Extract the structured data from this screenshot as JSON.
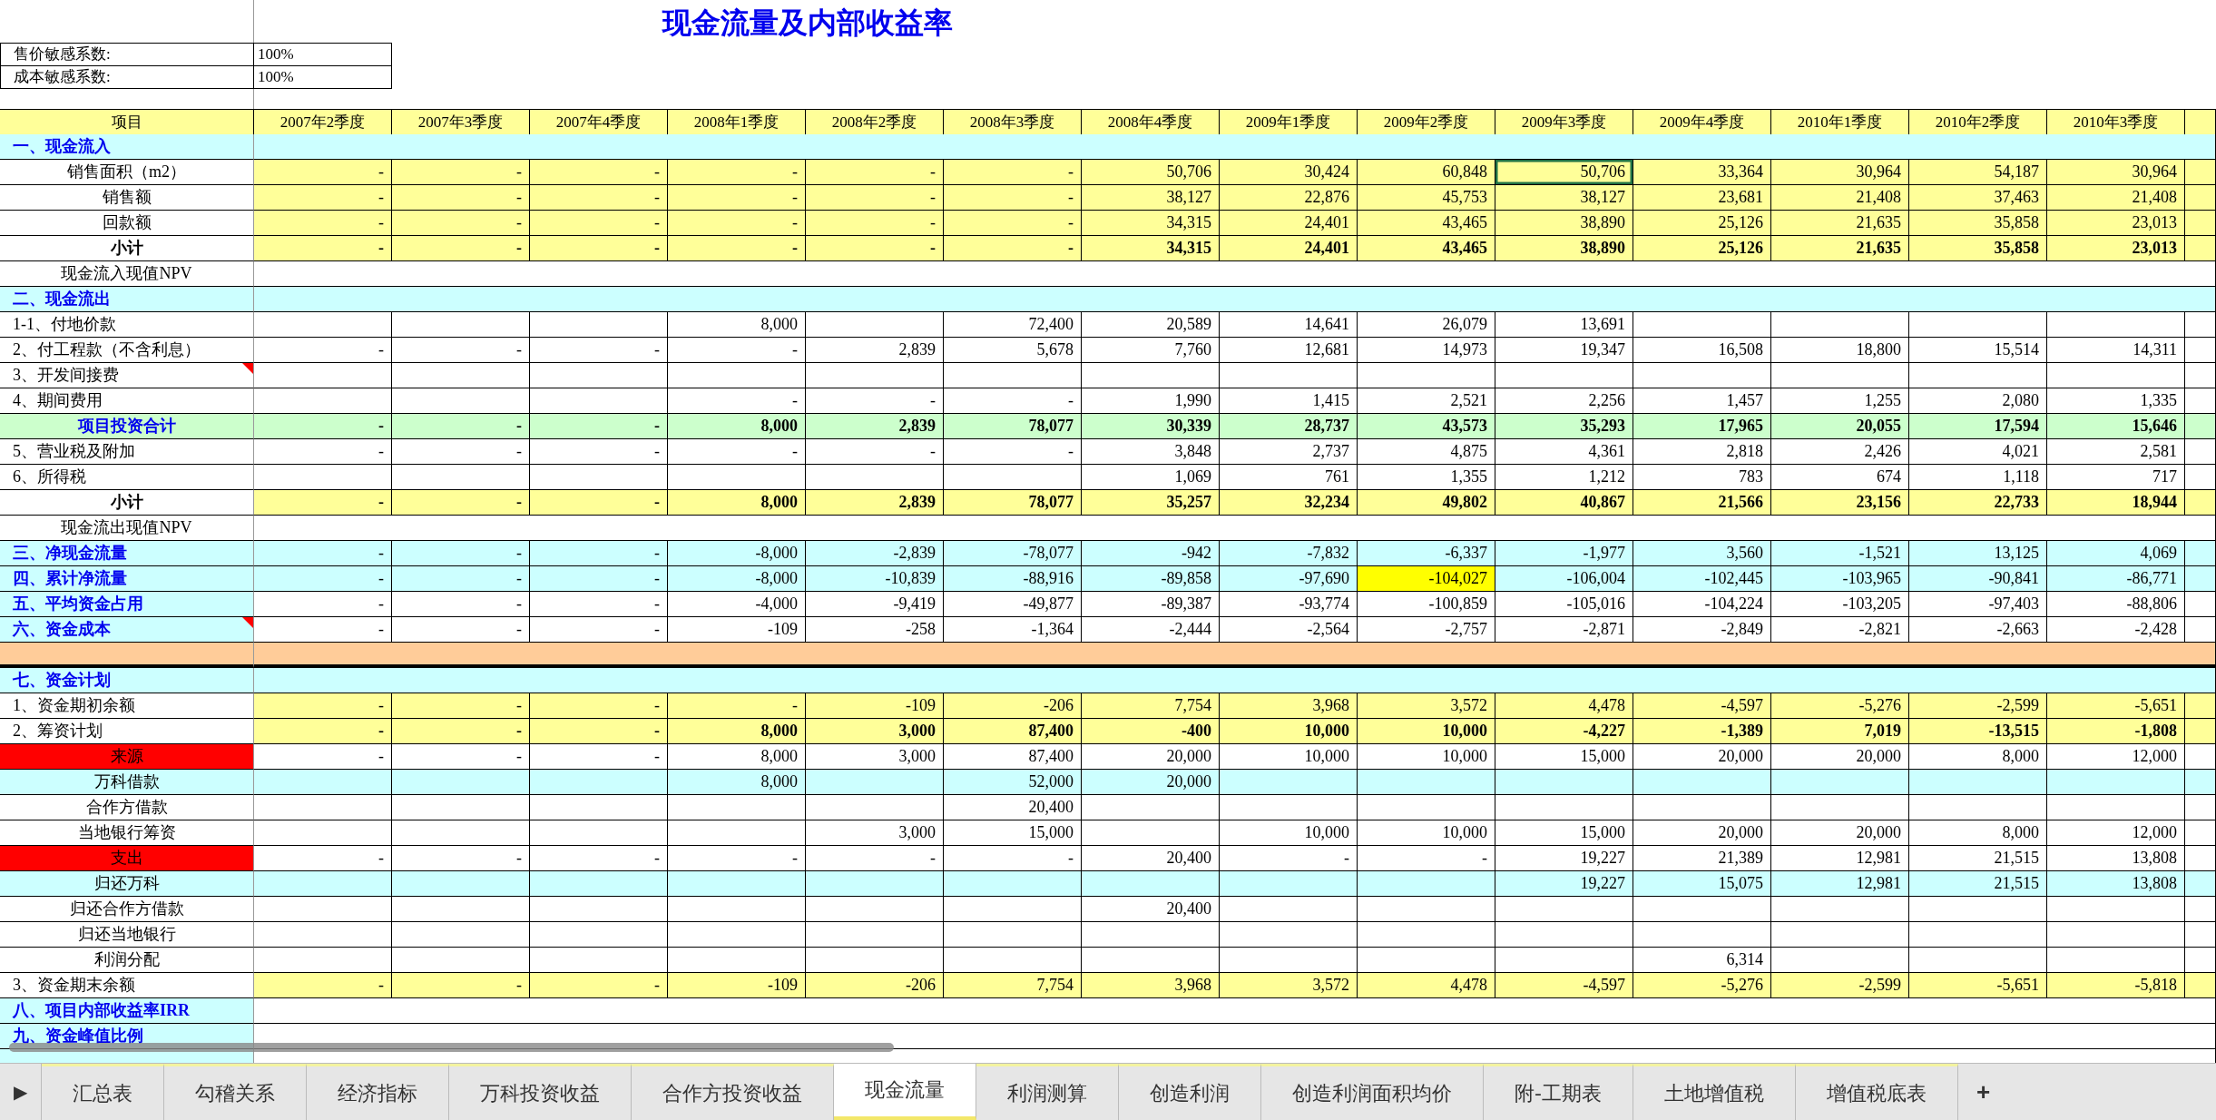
{
  "title": "现金流量及内部收益率",
  "sensitivity": [
    {
      "label": "售价敏感系数:",
      "value": "100%"
    },
    {
      "label": "成本敏感系数:",
      "value": "100%"
    }
  ],
  "header_label": "项目",
  "columns": [
    "2007年2季度",
    "2007年3季度",
    "2007年4季度",
    "2008年1季度",
    "2008年2季度",
    "2008年3季度",
    "2008年4季度",
    "2009年1季度",
    "2009年2季度",
    "2009年3季度",
    "2009年4季度",
    "2010年1季度",
    "2010年2季度",
    "2010年3季度"
  ],
  "rows": [
    {
      "label": "一、现金流入",
      "kind": "section"
    },
    {
      "label": "销售面积（m2）",
      "kind": "yellow_sub",
      "values": [
        "-",
        "-",
        "-",
        "-",
        "-",
        "-",
        "50,706",
        "30,424",
        "60,848",
        {
          "kind": "value",
          "text": "50,706",
          "selected": true
        },
        "33,364",
        "30,964",
        "54,187",
        "30,964"
      ]
    },
    {
      "label": "销售额",
      "kind": "yellow_sub",
      "values": [
        "-",
        "-",
        "-",
        "-",
        "-",
        "-",
        "38,127",
        "22,876",
        "45,753",
        "38,127",
        "23,681",
        "21,408",
        "37,463",
        "21,408"
      ]
    },
    {
      "label": "回款额",
      "kind": "yellow_sub",
      "values": [
        "-",
        "-",
        "-",
        "-",
        "-",
        "-",
        "34,315",
        "24,401",
        "43,465",
        "38,890",
        "25,126",
        "21,635",
        "35,858",
        "23,013"
      ]
    },
    {
      "label": "小计",
      "kind": "subtotal",
      "values": [
        "-",
        "-",
        "-",
        "-",
        "-",
        "-",
        "34,315",
        "24,401",
        "43,465",
        "38,890",
        "25,126",
        "21,635",
        "35,858",
        "23,013"
      ]
    },
    {
      "label": "现金流入现值NPV",
      "kind": "note"
    },
    {
      "label": "二、现金流出",
      "kind": "section"
    },
    {
      "label": "1-1、付地价款",
      "kind": "plain",
      "values": [
        {
          "kind": "blank"
        },
        {
          "kind": "blank"
        },
        {
          "kind": "blank"
        },
        "8,000",
        {
          "kind": "blank"
        },
        "72,400",
        "20,589",
        "14,641",
        "26,079",
        "13,691",
        {
          "kind": "blank"
        },
        {
          "kind": "blank"
        },
        {
          "kind": "blank"
        },
        {
          "kind": "blank"
        }
      ]
    },
    {
      "label": "2、付工程款（不含利息）",
      "kind": "plain",
      "values": [
        "-",
        "-",
        "-",
        "-",
        "2,839",
        "5,678",
        "7,760",
        "12,681",
        "14,973",
        "19,347",
        "16,508",
        "18,800",
        "15,514",
        "14,311"
      ]
    },
    {
      "label": "3、开发间接费",
      "kind": "plain",
      "comment": true
    },
    {
      "label": "4、期间费用",
      "kind": "plain",
      "values": [
        {
          "kind": "blank"
        },
        {
          "kind": "blank"
        },
        {
          "kind": "blank"
        },
        "-",
        "-",
        "-",
        "1,990",
        "1,415",
        "2,521",
        "2,256",
        "1,457",
        "1,255",
        "2,080",
        "1,335"
      ]
    },
    {
      "label": "项目投资合计",
      "kind": "green_total",
      "values": [
        "-",
        "-",
        "-",
        "8,000",
        "2,839",
        "78,077",
        "30,339",
        "28,737",
        "43,573",
        "35,293",
        "17,965",
        "20,055",
        "17,594",
        "15,646"
      ]
    },
    {
      "label": "5、营业税及附加",
      "kind": "plain",
      "values": [
        "-",
        "-",
        "-",
        "-",
        "-",
        "-",
        "3,848",
        "2,737",
        "4,875",
        "4,361",
        "2,818",
        "2,426",
        "4,021",
        "2,581"
      ]
    },
    {
      "label": "6、所得税",
      "kind": "plain",
      "values": [
        {
          "kind": "blank"
        },
        {
          "kind": "blank"
        },
        {
          "kind": "blank"
        },
        {
          "kind": "blank"
        },
        {
          "kind": "blank"
        },
        {
          "kind": "blank"
        },
        "1,069",
        "761",
        "1,355",
        "1,212",
        "783",
        "674",
        "1,118",
        "717"
      ]
    },
    {
      "label": "小计",
      "kind": "subtotal",
      "values": [
        "-",
        "-",
        "-",
        "8,000",
        "2,839",
        "78,077",
        "35,257",
        "32,234",
        "49,802",
        "40,867",
        "21,566",
        "23,156",
        "22,733",
        "18,944"
      ]
    },
    {
      "label": "现金流出现值NPV",
      "kind": "note"
    },
    {
      "label": "三、净现金流量",
      "kind": "section_cyan",
      "values": [
        "-",
        "-",
        "-",
        "-8,000",
        "-2,839",
        "-78,077",
        "-942",
        "-7,832",
        "-6,337",
        "-1,977",
        "3,560",
        "-1,521",
        "13,125",
        "4,069"
      ]
    },
    {
      "label": "四、累计净流量",
      "kind": "section_cyan",
      "values": [
        "-",
        "-",
        "-",
        "-8,000",
        "-10,839",
        "-88,916",
        "-89,858",
        "-97,690",
        {
          "kind": "value",
          "text": "-104,027",
          "highlighted": true
        },
        "-106,004",
        "-102,445",
        "-103,965",
        "-90,841",
        "-86,771"
      ]
    },
    {
      "label": "五、平均资金占用",
      "kind": "section_white",
      "values": [
        "-",
        "-",
        "-",
        "-4,000",
        "-9,419",
        "-49,877",
        "-89,387",
        "-93,774",
        "-100,859",
        "-105,016",
        "-104,224",
        "-103,205",
        "-97,403",
        "-88,806"
      ]
    },
    {
      "label": "六、资金成本",
      "kind": "section_white",
      "comment": true,
      "values": [
        "-",
        "-",
        "-",
        "-109",
        "-258",
        "-1,364",
        "-2,444",
        "-2,564",
        "-2,757",
        "-2,871",
        "-2,849",
        "-2,821",
        "-2,663",
        "-2,428"
      ]
    },
    {
      "kind": "separator"
    },
    {
      "label": "七、资金计划",
      "kind": "section"
    },
    {
      "label": "1、资金期初余额",
      "kind": "yellow",
      "values": [
        "-",
        "-",
        "-",
        "-",
        "-109",
        "-206",
        "7,754",
        "3,968",
        "3,572",
        "4,478",
        "-4,597",
        "-5,276",
        "-2,599",
        "-5,651"
      ]
    },
    {
      "label": "2、筹资计划",
      "kind": "yellow_bold",
      "values": [
        "-",
        "-",
        "-",
        "8,000",
        "3,000",
        "87,400",
        "-400",
        "10,000",
        "10,000",
        "-4,227",
        "-1,389",
        "7,019",
        "-13,515",
        "-1,808"
      ]
    },
    {
      "label": "来源",
      "kind": "red",
      "values": [
        "-",
        "-",
        "-",
        "8,000",
        "3,000",
        "87,400",
        "20,000",
        "10,000",
        "10,000",
        "15,000",
        "20,000",
        "20,000",
        "8,000",
        "12,000"
      ]
    },
    {
      "label": "万科借款",
      "kind": "cyan",
      "values": [
        {
          "kind": "blank"
        },
        {
          "kind": "blank"
        },
        {
          "kind": "blank"
        },
        "8,000",
        {
          "kind": "blank"
        },
        "52,000",
        "20,000",
        {
          "kind": "blank"
        },
        {
          "kind": "blank"
        },
        {
          "kind": "blank"
        },
        {
          "kind": "blank"
        },
        {
          "kind": "blank"
        },
        {
          "kind": "blank"
        },
        {
          "kind": "blank"
        }
      ]
    },
    {
      "label": "合作方借款",
      "kind": "plain_sub",
      "values": [
        {
          "kind": "blank"
        },
        {
          "kind": "blank"
        },
        {
          "kind": "blank"
        },
        {
          "kind": "blank"
        },
        {
          "kind": "blank"
        },
        "20,400",
        {
          "kind": "blank"
        },
        {
          "kind": "blank"
        },
        {
          "kind": "blank"
        },
        {
          "kind": "blank"
        },
        {
          "kind": "blank"
        },
        {
          "kind": "blank"
        },
        {
          "kind": "blank"
        },
        {
          "kind": "blank"
        }
      ]
    },
    {
      "label": "当地银行筹资",
      "kind": "plain_sub",
      "values": [
        {
          "kind": "blank"
        },
        {
          "kind": "blank"
        },
        {
          "kind": "blank"
        },
        {
          "kind": "blank"
        },
        "3,000",
        "15,000",
        {
          "kind": "blank"
        },
        "10,000",
        "10,000",
        "15,000",
        "20,000",
        "20,000",
        "8,000",
        "12,000"
      ]
    },
    {
      "label": "支出",
      "kind": "red",
      "values": [
        "-",
        "-",
        "-",
        "-",
        "-",
        "-",
        "20,400",
        "-",
        "-",
        "19,227",
        "21,389",
        "12,981",
        "21,515",
        "13,808"
      ]
    },
    {
      "label": "归还万科",
      "kind": "cyan",
      "values": [
        {
          "kind": "blank"
        },
        {
          "kind": "blank"
        },
        {
          "kind": "blank"
        },
        {
          "kind": "blank"
        },
        {
          "kind": "blank"
        },
        {
          "kind": "blank"
        },
        {
          "kind": "blank"
        },
        {
          "kind": "blank"
        },
        {
          "kind": "blank"
        },
        "19,227",
        "15,075",
        "12,981",
        "21,515",
        "13,808"
      ]
    },
    {
      "label": "归还合作方借款",
      "kind": "plain_sub",
      "values": [
        {
          "kind": "blank"
        },
        {
          "kind": "blank"
        },
        {
          "kind": "blank"
        },
        {
          "kind": "blank"
        },
        {
          "kind": "blank"
        },
        {
          "kind": "blank"
        },
        "20,400",
        {
          "kind": "blank"
        },
        {
          "kind": "blank"
        },
        {
          "kind": "blank"
        },
        {
          "kind": "blank"
        },
        {
          "kind": "blank"
        },
        {
          "kind": "blank"
        },
        {
          "kind": "blank"
        }
      ]
    },
    {
      "label": "归还当地银行",
      "kind": "plain_sub"
    },
    {
      "label": "利润分配",
      "kind": "plain_sub",
      "values": [
        {
          "kind": "blank"
        },
        {
          "kind": "blank"
        },
        {
          "kind": "blank"
        },
        {
          "kind": "blank"
        },
        {
          "kind": "blank"
        },
        {
          "kind": "blank"
        },
        {
          "kind": "blank"
        },
        {
          "kind": "blank"
        },
        {
          "kind": "blank"
        },
        {
          "kind": "blank"
        },
        "6,314",
        {
          "kind": "blank"
        },
        {
          "kind": "blank"
        },
        {
          "kind": "blank"
        }
      ]
    },
    {
      "label": "3、资金期末余额",
      "kind": "yellow",
      "values": [
        "-",
        "-",
        "-",
        "-109",
        "-206",
        "7,754",
        "3,968",
        "3,572",
        "4,478",
        "-4,597",
        "-5,276",
        "-2,599",
        "-5,651",
        "-5,818"
      ]
    },
    {
      "label": "八、项目内部收益率IRR",
      "kind": "section_note"
    },
    {
      "label": "九、资金峰值比例",
      "kind": "section_note"
    },
    {
      "kind": "section_note"
    }
  ],
  "sheet_tabs": {
    "scroll_button": "▶",
    "add_button": "+",
    "tabs": [
      {
        "label": "汇总表",
        "selected": false
      },
      {
        "label": "勾稽关系",
        "selected": false
      },
      {
        "label": "经济指标",
        "selected": false
      },
      {
        "label": "万科投资收益",
        "selected": false
      },
      {
        "label": "合作方投资收益",
        "selected": false
      },
      {
        "label": "现金流量",
        "selected": true
      },
      {
        "label": "利润测算",
        "selected": false
      },
      {
        "label": "创造利润",
        "selected": false
      },
      {
        "label": "创造利润面积均价",
        "selected": false
      },
      {
        "label": "附-工期表",
        "selected": false
      },
      {
        "label": "土地增值税",
        "selected": false
      },
      {
        "label": "增值税底表",
        "selected": false
      }
    ]
  }
}
